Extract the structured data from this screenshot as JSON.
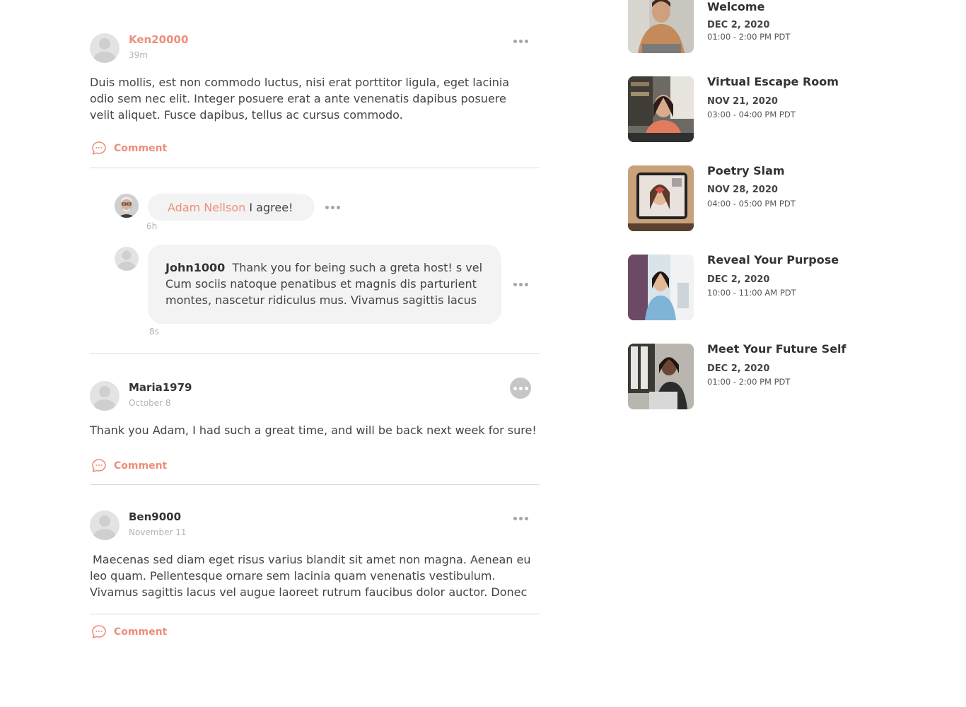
{
  "posts": [
    {
      "username": "Ken20000",
      "time": "39m",
      "body": "Duis mollis, est non commodo luctus, nisi erat porttitor ligula, eget lacinia odio sem nec elit. Integer posuere erat a ante venenatis dapibus posuere velit aliquet. Fusce dapibus, tellus ac cursus commodo.",
      "comment_label": "Comment",
      "replies": [
        {
          "username": "Adam Nellson",
          "text": "I agree!",
          "time": "6h"
        },
        {
          "username": "John1000",
          "text": "Thank you for being such a greta host! s vel Cum sociis natoque penatibus et magnis dis parturient montes, nascetur ridiculus mus. Vivamus sagittis lacus",
          "time": "8s"
        }
      ]
    },
    {
      "username": "Maria1979",
      "time": "October 8",
      "body": "Thank you Adam, I had such a great time, and will be back next week for sure!",
      "comment_label": "Comment"
    },
    {
      "username": "Ben9000",
      "time": "November 11",
      "body": "Maecenas sed diam eget risus varius blandit sit amet non magna. Aenean eu leo quam. Pellentesque ornare sem lacinia quam venenatis vestibulum. Vivamus sagittis lacus vel augue laoreet rutrum faucibus dolor auctor. Donec",
      "comment_label": "Comment"
    }
  ],
  "events": [
    {
      "title": "Welcome",
      "date": "DEC 2, 2020",
      "time": "01:00 - 2:00 PM PDT"
    },
    {
      "title": "Virtual Escape Room",
      "date": "NOV 21, 2020",
      "time": "03:00 - 04:00 PM PDT"
    },
    {
      "title": "Poetry Slam",
      "date": "NOV 28, 2020",
      "time": "04:00 - 05:00 PM PDT"
    },
    {
      "title": "Reveal Your Purpose",
      "date": "DEC 2, 2020",
      "time": "10:00 - 11:00 AM PDT"
    },
    {
      "title": "Meet Your Future Self",
      "date": "DEC 2, 2020",
      "time": "01:00 - 2:00 PM PDT"
    }
  ],
  "colors": {
    "accent": "#ec8f7c",
    "text": "#333333",
    "muted": "#b3b3b3",
    "bubble": "#f3f3f3"
  },
  "icons": {
    "comment": "chat-bubble-icon",
    "more": "more-dots-icon",
    "avatar": "default-avatar-icon"
  }
}
